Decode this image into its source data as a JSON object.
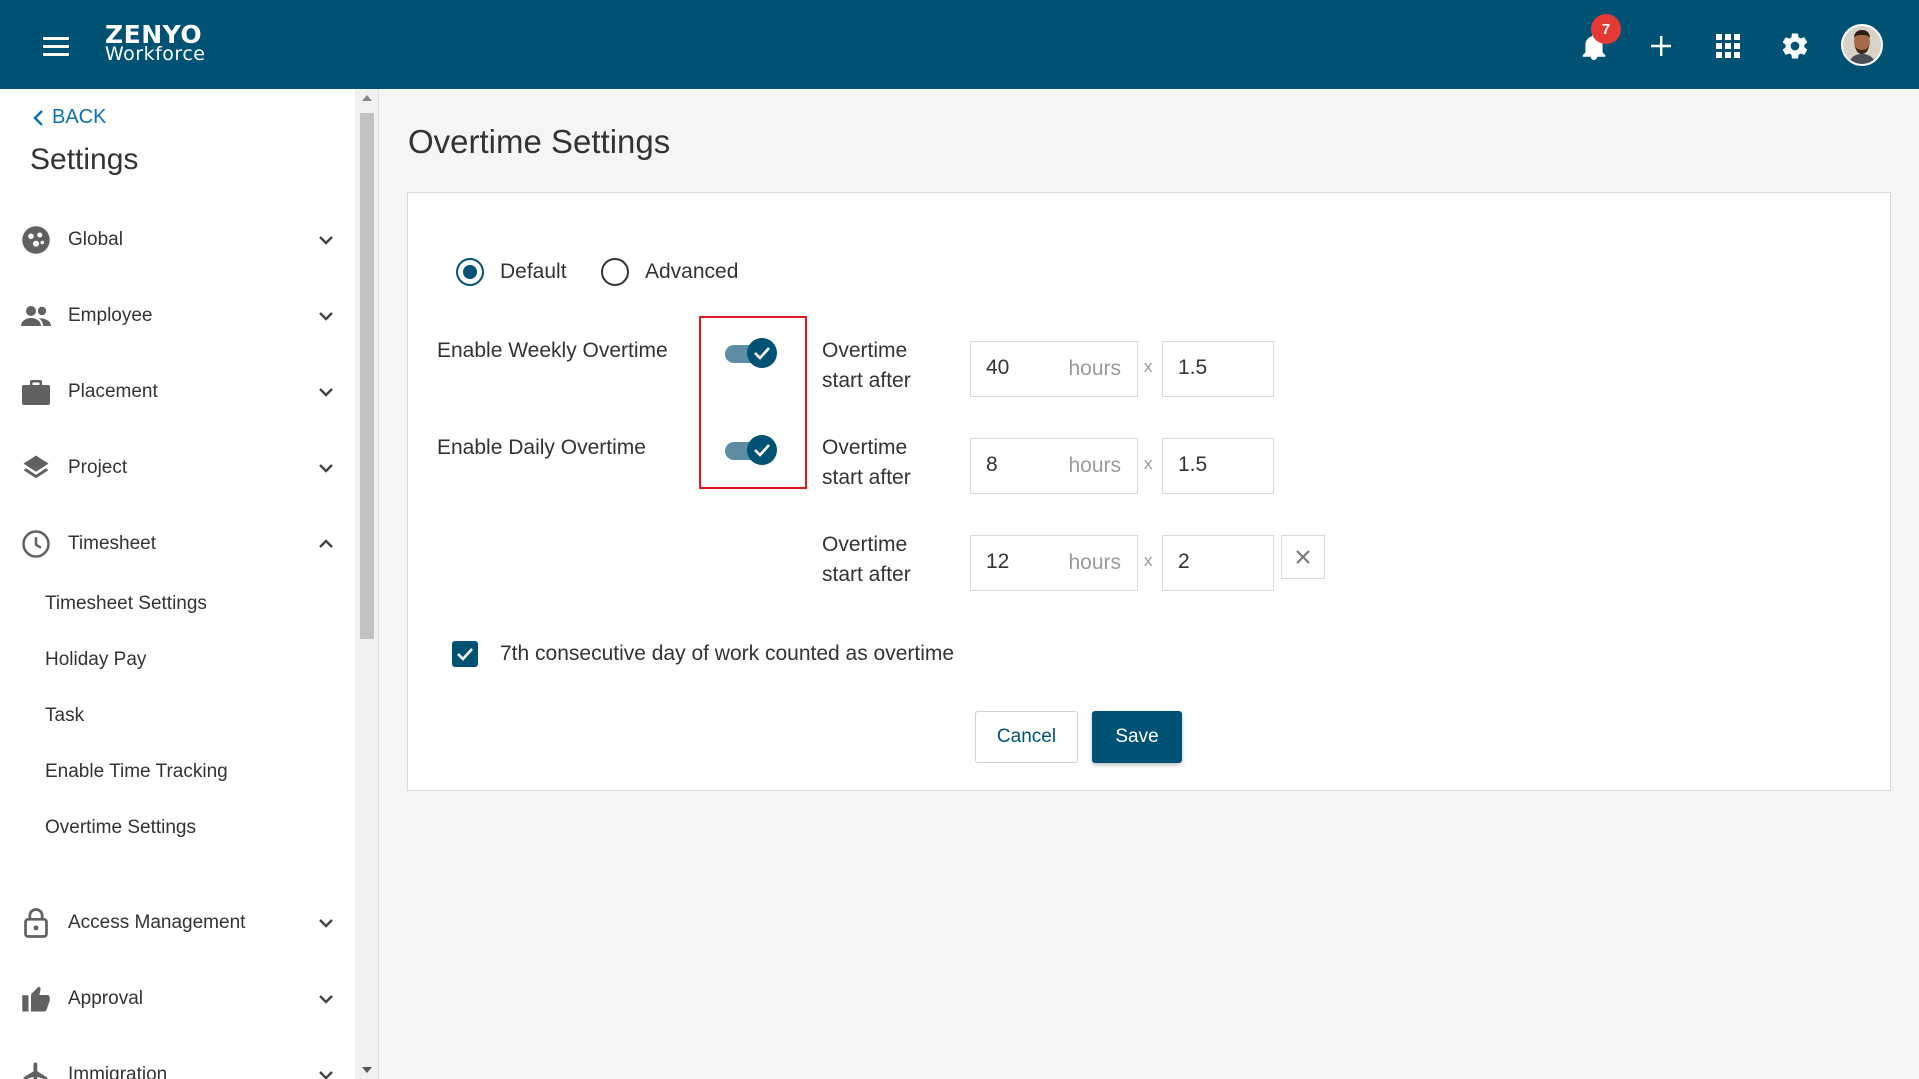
{
  "header": {
    "logo_top": "ZENYO",
    "logo_bottom": "Workforce",
    "notification_count": "7",
    "brand_color": "#005274"
  },
  "sidebar": {
    "back_label": "BACK",
    "title": "Settings",
    "items": [
      {
        "label": "Global",
        "icon": "globe-icon",
        "expanded": false
      },
      {
        "label": "Employee",
        "icon": "people-icon",
        "expanded": false
      },
      {
        "label": "Placement",
        "icon": "briefcase-icon",
        "expanded": false
      },
      {
        "label": "Project",
        "icon": "layers-icon",
        "expanded": false
      },
      {
        "label": "Timesheet",
        "icon": "clock-icon",
        "expanded": true
      },
      {
        "label": "Access Management",
        "icon": "lock-icon",
        "expanded": false
      },
      {
        "label": "Approval",
        "icon": "thumbs-up-icon",
        "expanded": false
      },
      {
        "label": "Immigration",
        "icon": "airplane-icon",
        "expanded": false
      }
    ],
    "timesheet_subitems": [
      "Timesheet Settings",
      "Holiday Pay",
      "Task",
      "Enable Time Tracking",
      "Overtime Settings"
    ]
  },
  "main": {
    "title": "Overtime Settings",
    "mode_options": [
      "Default",
      "Advanced"
    ],
    "selected_mode": "Default",
    "weekly_label": "Enable Weekly Overtime",
    "daily_label": "Enable Daily Overtime",
    "weekly_enabled": true,
    "daily_enabled": true,
    "ot_label_line1": "Overtime",
    "ot_label_line2": "start after",
    "hours_unit": "hours",
    "times_symbol": "x",
    "rules": [
      {
        "hours": "40",
        "multiplier": "1.5"
      },
      {
        "hours": "8",
        "multiplier": "1.5"
      },
      {
        "hours": "12",
        "multiplier": "2"
      }
    ],
    "seventh_day_label": "7th consecutive day of work counted as overtime",
    "seventh_day_checked": true,
    "cancel_label": "Cancel",
    "save_label": "Save"
  }
}
